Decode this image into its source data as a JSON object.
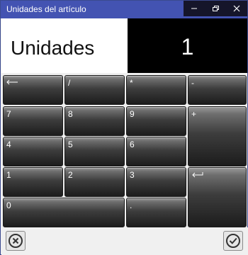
{
  "window": {
    "title": "Unidades del artículo",
    "controls": [
      "minimize-icon",
      "restore-icon",
      "close-icon"
    ]
  },
  "label": "Unidades",
  "display": {
    "value": "1"
  },
  "keys": {
    "backspace": "",
    "divide": "/",
    "multiply": "*",
    "minus": "-",
    "seven": "7",
    "eight": "8",
    "nine": "9",
    "plus": "+",
    "four": "4",
    "five": "5",
    "six": "6",
    "one": "1",
    "two": "2",
    "three": "3",
    "enter": "",
    "zero": "0",
    "decimal": "."
  },
  "footer": {
    "cancel_icon": "cancel-circle-icon",
    "ok_icon": "checkmark-circle-icon"
  }
}
